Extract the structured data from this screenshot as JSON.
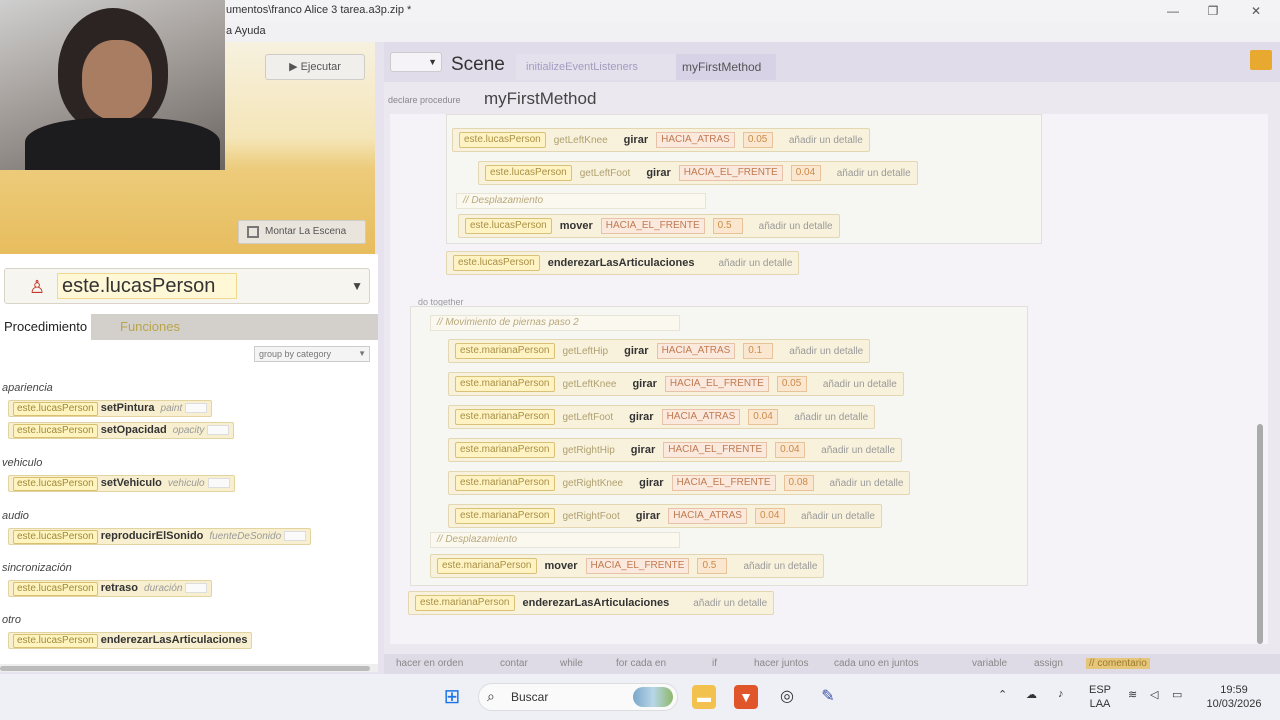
{
  "window": {
    "title": "umentos\\franco Alice 3 tarea.a3p.zip *",
    "menu_help": "a  Ayuda",
    "min": "—",
    "max": "❐",
    "close": "✕"
  },
  "scene_preview": {
    "run_label": "Ejecutar",
    "mount_label": "Montar La Escena"
  },
  "object_selector": {
    "value": "este.lucasPerson"
  },
  "tabs": {
    "procedures": "Procedimiento",
    "functions": "Funciones"
  },
  "group_select": "group by category",
  "categories": [
    {
      "name": "apariencia"
    },
    {
      "name": "vehiculo"
    },
    {
      "name": "audio"
    },
    {
      "name": "sincronización"
    },
    {
      "name": "otro"
    }
  ],
  "procedures": [
    {
      "obj": "este.lucasPerson",
      "method": "setPintura",
      "arg": "paint"
    },
    {
      "obj": "este.lucasPerson",
      "method": "setOpacidad",
      "arg": "opacity"
    },
    {
      "obj": "este.lucasPerson",
      "method": "setVehiculo",
      "arg": "vehiculo"
    },
    {
      "obj": "este.lucasPerson",
      "method": "reproducirElSonido",
      "arg": "fuenteDeSonido"
    },
    {
      "obj": "este.lucasPerson",
      "method": "retraso",
      "arg": "duración"
    },
    {
      "obj": "este.lucasPerson",
      "method": "enderezarLasArticulaciones",
      "arg": ""
    }
  ],
  "editor": {
    "tab_scene": "Scene",
    "tab_second": "initializeEventListeners",
    "tab_active": "myFirstMethod",
    "declare_label": "declare procedure",
    "method_name": "myFirstMethod",
    "do_together_label": "do together",
    "comment_lucas": "// Desplazamiento",
    "comment_mariana_move": "// Movimiento de piernas paso 2",
    "comment_mariana_disp": "// Desplazamiento",
    "statements_lucas": [
      {
        "obj": "este.lucasPerson",
        "getter": "getLeftKnee",
        "verb": "girar",
        "dir": "HACIA_ATRAS",
        "num": "0.05",
        "detail": "añadir un detalle"
      },
      {
        "obj": "este.lucasPerson",
        "getter": "getLeftFoot",
        "verb": "girar",
        "dir": "HACIA_EL_FRENTE",
        "num": "0.04",
        "detail": "añadir un detalle"
      },
      {
        "obj": "este.lucasPerson",
        "getter": "",
        "verb": "mover",
        "dir": "HACIA_EL_FRENTE",
        "num": "0.5",
        "detail": "añadir un detalle"
      }
    ],
    "straighten_lucas": {
      "obj": "este.lucasPerson",
      "verb": "enderezarLasArticulaciones",
      "detail": "añadir un detalle"
    },
    "statements_mariana": [
      {
        "obj": "este.marianaPerson",
        "getter": "getLeftHip",
        "verb": "girar",
        "dir": "HACIA_ATRAS",
        "num": "0.1",
        "detail": "añadir un detalle"
      },
      {
        "obj": "este.marianaPerson",
        "getter": "getLeftKnee",
        "verb": "girar",
        "dir": "HACIA_EL_FRENTE",
        "num": "0.05",
        "detail": "añadir un detalle"
      },
      {
        "obj": "este.marianaPerson",
        "getter": "getLeftFoot",
        "verb": "girar",
        "dir": "HACIA_ATRAS",
        "num": "0.04",
        "detail": "añadir un detalle"
      },
      {
        "obj": "este.marianaPerson",
        "getter": "getRightHip",
        "verb": "girar",
        "dir": "HACIA_EL_FRENTE",
        "num": "0.04",
        "detail": "añadir un detalle"
      },
      {
        "obj": "este.marianaPerson",
        "getter": "getRightKnee",
        "verb": "girar",
        "dir": "HACIA_EL_FRENTE",
        "num": "0.08",
        "detail": "añadir un detalle"
      },
      {
        "obj": "este.marianaPerson",
        "getter": "getRightFoot",
        "verb": "girar",
        "dir": "HACIA_ATRAS",
        "num": "0.04",
        "detail": "añadir un detalle"
      }
    ],
    "move_mariana": {
      "obj": "este.marianaPerson",
      "verb": "mover",
      "dir": "HACIA_EL_FRENTE",
      "num": "0.5",
      "detail": "añadir un detalle"
    },
    "straighten_mariana": {
      "obj": "este.marianaPerson",
      "verb": "enderezarLasArticulaciones",
      "detail": "añadir un detalle"
    }
  },
  "footer_blocks": [
    "hacer en orden",
    "contar",
    "while",
    "for cada en",
    "if",
    "hacer juntos",
    "cada uno en juntos",
    "variable",
    "assign",
    "// comentario"
  ],
  "taskbar": {
    "search": "Buscar",
    "lang1": "ESP",
    "lang2": "LAA",
    "time": "19:59",
    "date": "10/03/2026"
  }
}
